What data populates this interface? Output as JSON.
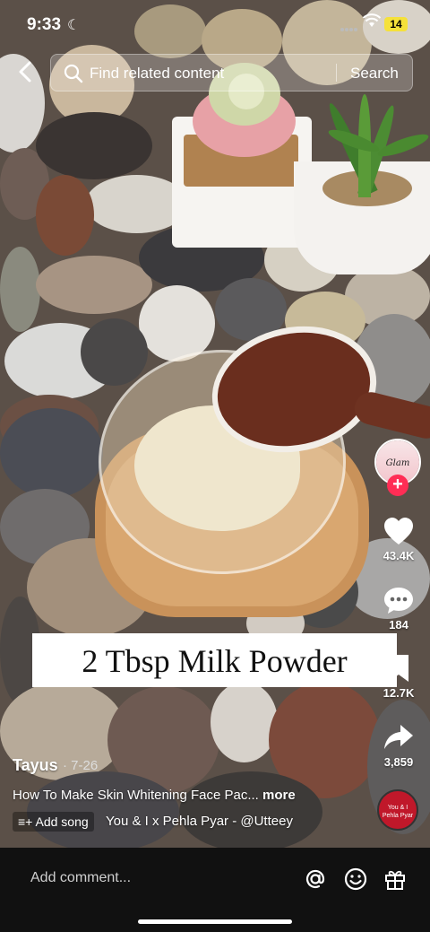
{
  "status_bar": {
    "time": "9:33",
    "battery": "14"
  },
  "search": {
    "placeholder": "Find related content",
    "button": "Search"
  },
  "video": {
    "caption": "2 Tbsp Milk Powder"
  },
  "creator": {
    "avatar_text": "Glam Tayus"
  },
  "actions": {
    "likes": "43.4K",
    "comments": "184",
    "saves": "12.7K",
    "shares": "3,859"
  },
  "post": {
    "author": "Tayus",
    "date": "· 7-26",
    "description": "How To Make Skin Whitening Face Pac...",
    "more": "more",
    "add_song": "Add song",
    "song": "You & I x Pehla Pyar - @Utteey",
    "disc_label": "You & I Pehla Pyar"
  },
  "bottom": {
    "comment_placeholder": "Add comment..."
  }
}
